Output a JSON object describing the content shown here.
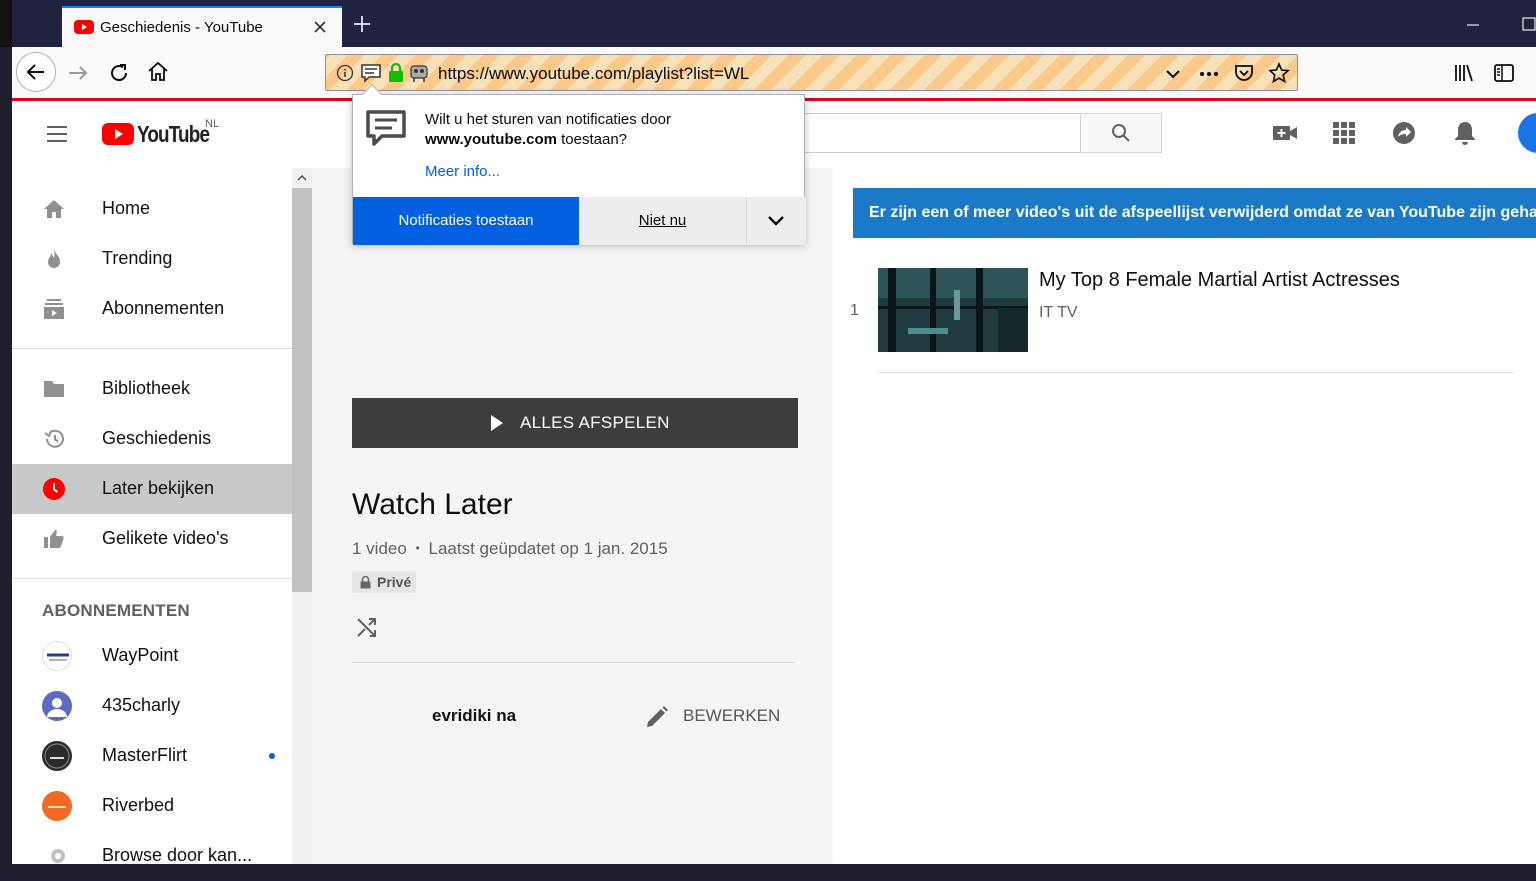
{
  "browser": {
    "tab_title": "Geschiedenis - YouTube",
    "url": "https://www.youtube.com/playlist?list=WL"
  },
  "youtube": {
    "logo_text": "YouTube",
    "region": "NL"
  },
  "sidebar": {
    "main": [
      {
        "label": "Home",
        "icon": "home-icon"
      },
      {
        "label": "Trending",
        "icon": "flame-icon"
      },
      {
        "label": "Abonnementen",
        "icon": "subscriptions-icon"
      }
    ],
    "library": [
      {
        "label": "Bibliotheek",
        "icon": "folder-icon"
      },
      {
        "label": "Geschiedenis",
        "icon": "history-icon"
      },
      {
        "label": "Later bekijken",
        "icon": "watch-later-icon"
      },
      {
        "label": "Gelikete video's",
        "icon": "thumbs-up-icon"
      }
    ],
    "subs_heading": "ABONNEMENTEN",
    "subscriptions": [
      {
        "label": "WayPoint"
      },
      {
        "label": "435charly"
      },
      {
        "label": "MasterFlirt"
      },
      {
        "label": "Riverbed"
      },
      {
        "label": "Browse door kan..."
      }
    ]
  },
  "popup": {
    "message_line1": "Wilt u het sturen van notificaties door",
    "domain": "www.youtube.com",
    "message_tail": " toestaan?",
    "more_info": "Meer info...",
    "allow_label": "Notificaties toestaan",
    "not_now_label": "Niet nu"
  },
  "playlist": {
    "play_all": "ALLES AFSPELEN",
    "title": "Watch Later",
    "video_count": "1 video",
    "updated": "Laatst geüpdatet op 1 jan. 2015",
    "privacy": "Privé",
    "owner": "evridiki na",
    "edit_label": "BEWERKEN"
  },
  "banner": "Er zijn een of meer video's uit de afspeellijst verwijderd omdat ze van YouTube zijn gehaald.",
  "videos": [
    {
      "index": "1",
      "title": "My Top 8 Female Martial Artist Actresses",
      "channel": "IT TV"
    }
  ],
  "colors": {
    "youtube_red": "#ff0000",
    "firefox_blue": "#0060df",
    "banner_blue": "#1a7ac7"
  }
}
